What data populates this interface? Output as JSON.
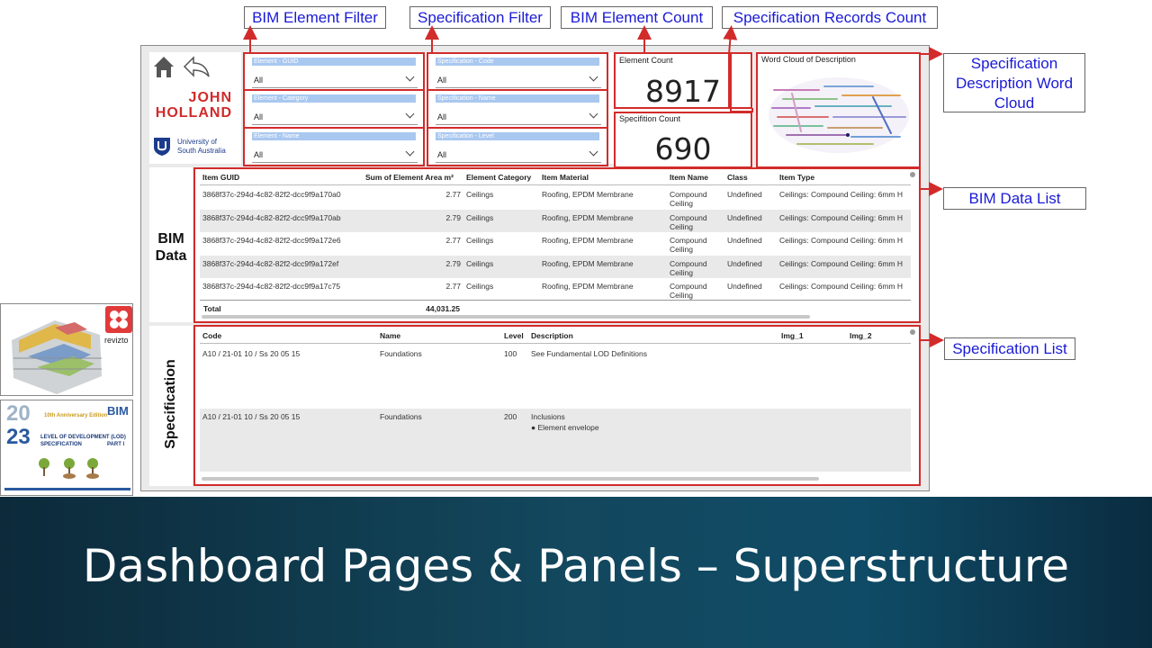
{
  "callouts": {
    "bim_element_filter": "BIM Element Filter",
    "specification_filter": "Specification Filter",
    "bim_element_count": "BIM Element Count",
    "specification_records_count": "Specification Records Count",
    "word_cloud": "Specification Description Word Cloud",
    "bim_data_list": "BIM Data List",
    "specification_list": "Specification List"
  },
  "logos": {
    "company": [
      "JOHN",
      "HOLLAND"
    ],
    "university": [
      "University of",
      "South Australia"
    ],
    "revizto": "revizto"
  },
  "element_filters": [
    {
      "title": "Element - GUID",
      "value": "All"
    },
    {
      "title": "Element - Category",
      "value": "All"
    },
    {
      "title": "Element - Name",
      "value": "All"
    }
  ],
  "spec_filters": [
    {
      "title": "Specification - Code",
      "value": "All"
    },
    {
      "title": "Specification - Name",
      "value": "All"
    },
    {
      "title": "Specification - Level",
      "value": "All"
    }
  ],
  "cards": {
    "element_count_label": "Element Count",
    "element_count_value": "8917",
    "spec_count_label": "Specifition Count",
    "spec_count_value": "690",
    "word_cloud_label": "Word Cloud of Description"
  },
  "bim_section_label": "BIM Data",
  "spec_section_label": "Specification",
  "bim_table": {
    "headers": [
      "Item GUID",
      "Sum of Element Area m²",
      "Element Category",
      "Item Material",
      "Item Name",
      "Class",
      "Item Type"
    ],
    "rows": [
      [
        "3868f37c-294d-4c82-82f2-dcc9f9a170a0",
        "2.77",
        "Ceilings",
        "Roofing, EPDM Membrane",
        "Compound Ceiling",
        "Undefined",
        "Ceilings: Compound Ceiling: 6mm H"
      ],
      [
        "3868f37c-294d-4c82-82f2-dcc9f9a170ab",
        "2.79",
        "Ceilings",
        "Roofing, EPDM Membrane",
        "Compound Ceiling",
        "Undefined",
        "Ceilings: Compound Ceiling: 6mm H"
      ],
      [
        "3868f37c-294d-4c82-82f2-dcc9f9a172e6",
        "2.77",
        "Ceilings",
        "Roofing, EPDM Membrane",
        "Compound Ceiling",
        "Undefined",
        "Ceilings: Compound Ceiling: 6mm H"
      ],
      [
        "3868f37c-294d-4c82-82f2-dcc9f9a172ef",
        "2.79",
        "Ceilings",
        "Roofing, EPDM Membrane",
        "Compound Ceiling",
        "Undefined",
        "Ceilings: Compound Ceiling: 6mm H"
      ],
      [
        "3868f37c-294d-4c82-82f2-dcc9f9a17c75",
        "2.77",
        "Ceilings",
        "Roofing, EPDM Membrane",
        "Compound Ceiling",
        "Undefined",
        "Ceilings: Compound Ceiling: 6mm H"
      ]
    ],
    "total_label": "Total",
    "total_value": "44,031.25"
  },
  "spec_table": {
    "headers": [
      "Code",
      "Name",
      "Level",
      "Description",
      "Img_1",
      "Img_2"
    ],
    "rows": [
      {
        "code": "A10 / 21-01 10 / Ss 20 05 15",
        "name": "Foundations",
        "level": "100",
        "desc": [
          "See Fundamental LOD Definitions"
        ]
      },
      {
        "code": "A10 / 21-01 10 / Ss 20 05 15",
        "name": "Foundations",
        "level": "200",
        "desc": [
          "Inclusions",
          "● Element envelope"
        ]
      }
    ]
  },
  "lod_card": {
    "year_top": "20",
    "year_bottom": "23",
    "edition": "10th Anniversary Edition",
    "title_1": "LEVEL OF DEVELOPMENT (LOD)",
    "title_2": "SPECIFICATION",
    "part": "PART I",
    "brand": "BIM"
  },
  "footer_title": "Dashboard Pages & Panels – Superstructure"
}
